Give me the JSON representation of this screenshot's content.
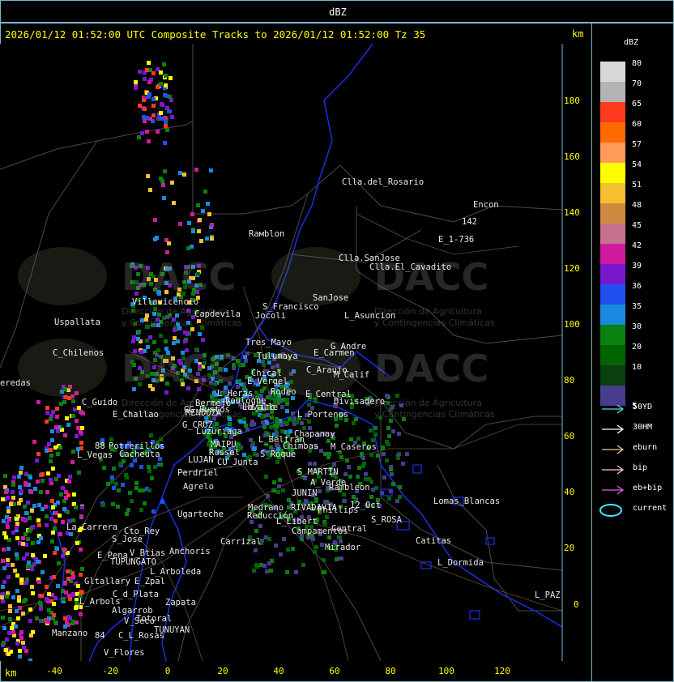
{
  "top_title": "dBZ",
  "header": "2026/01/12 01:52:00 UTC Composite Tracks to 2026/01/12 01:52:00 Tz 35",
  "axis_unit": "km",
  "y_ticks": [
    "180",
    "160",
    "140",
    "120",
    "100",
    "80",
    "60",
    "40",
    "20",
    "0"
  ],
  "x_ticks": [
    "-40",
    "-20",
    "0",
    "20",
    "40",
    "60",
    "80",
    "100",
    "120"
  ],
  "scale_title": "dBZ",
  "scale": [
    {
      "label": "80",
      "color": "#d8d8d8"
    },
    {
      "label": "70",
      "color": "#b4b4b4"
    },
    {
      "label": "65",
      "color": "#ff3a1e"
    },
    {
      "label": "60",
      "color": "#ff6a00"
    },
    {
      "label": "57",
      "color": "#ff9a5a"
    },
    {
      "label": "54",
      "color": "#ffff00"
    },
    {
      "label": "51",
      "color": "#f5c030"
    },
    {
      "label": "48",
      "color": "#d08a40"
    },
    {
      "label": "45",
      "color": "#c87090"
    },
    {
      "label": "42",
      "color": "#d01aa0"
    },
    {
      "label": "39",
      "color": "#7a18d0"
    },
    {
      "label": "36",
      "color": "#2050f0"
    },
    {
      "label": "35",
      "color": "#1a8ae0"
    },
    {
      "label": "30",
      "color": "#0a8010"
    },
    {
      "label": "20",
      "color": "#006400"
    },
    {
      "label": "10",
      "color": "#0a4010"
    },
    {
      "label": "5",
      "color": "#483c8c"
    }
  ],
  "legend": [
    {
      "label": "50YD",
      "color": "#5ad8e8"
    },
    {
      "label": "30HM",
      "color": "#ffffff"
    },
    {
      "label": "eburn",
      "color": "#e8c890"
    },
    {
      "label": "bip",
      "color": "#ffc8e0"
    },
    {
      "label": "eb+bip",
      "color": "#e060e0"
    },
    {
      "label": "current",
      "color": "#40e8ff"
    }
  ],
  "watermark": {
    "name": "DACC",
    "line1": "Dirección de Agricultura",
    "line2": "y Contingencias Climáticas"
  },
  "places": [
    "Clla.del_Rosario",
    "Encon",
    "142",
    "E_1-736",
    "Rамblon",
    "Clla.SanJose",
    "Clla.El_Cavadito",
    "Villavicencio",
    "Capdevila",
    "S_Francisco",
    "SanJose",
    "L_Asuncion",
    "Uspallata",
    "Jocoli",
    "Tres_Mayo",
    "G_Andre",
    "C_Chilenos",
    "Tulumaya",
    "E_Carmen",
    "C_Araujo",
    "M_Calif",
    "Chical",
    "E_Vergel",
    "Rodeo",
    "L_Heras",
    "Boulogne",
    "Lavalle",
    "E_Central",
    "Divisadero",
    "C_Guido",
    "E_Challao",
    "GG_Bustos",
    "MENDOZA",
    "Bermejo",
    "Hijito",
    "L_Portenos",
    "G_CRUZ",
    "Luzuriaga",
    "Chapanay",
    "L_Beltran",
    "Chimbas",
    "M_Caseros",
    "MAIPU",
    "Russel",
    "S_Roque",
    "Potrerillos",
    "L_Vegas",
    "Cacheuta",
    "LUJAN",
    "CU_Junta",
    "Perdriel",
    "S_MARTIN",
    "A_Verde",
    "Rambleon",
    "Agrelo",
    "Reducción",
    "JUNIN",
    "Medrano",
    "RIVADAVIA",
    "Phillips",
    "12_Oct",
    "Ugarteche",
    "S_ROSA",
    "Lomas_Blancas",
    "La_Carrera",
    "Cto_Rey",
    "L_Libert",
    "Campamentos",
    "Central",
    "S_Jose",
    "Carrizal",
    "Catitas",
    "E_Pena",
    "V_Btias",
    "Anchoris",
    "Mirador",
    "TUPUNGATO",
    "L_Arboleda",
    "L_Dormida",
    "Gltallary",
    "E_Zpal",
    "C_d_Plata",
    "L_Arbols",
    "Zapata",
    "Algarrob",
    "V_Seco",
    "Totoral",
    "TUNUYAN",
    "Manzano",
    "C_L_Rosas",
    "V_Flores",
    "L_PAZ",
    "eredas",
    "88",
    "84"
  ]
}
